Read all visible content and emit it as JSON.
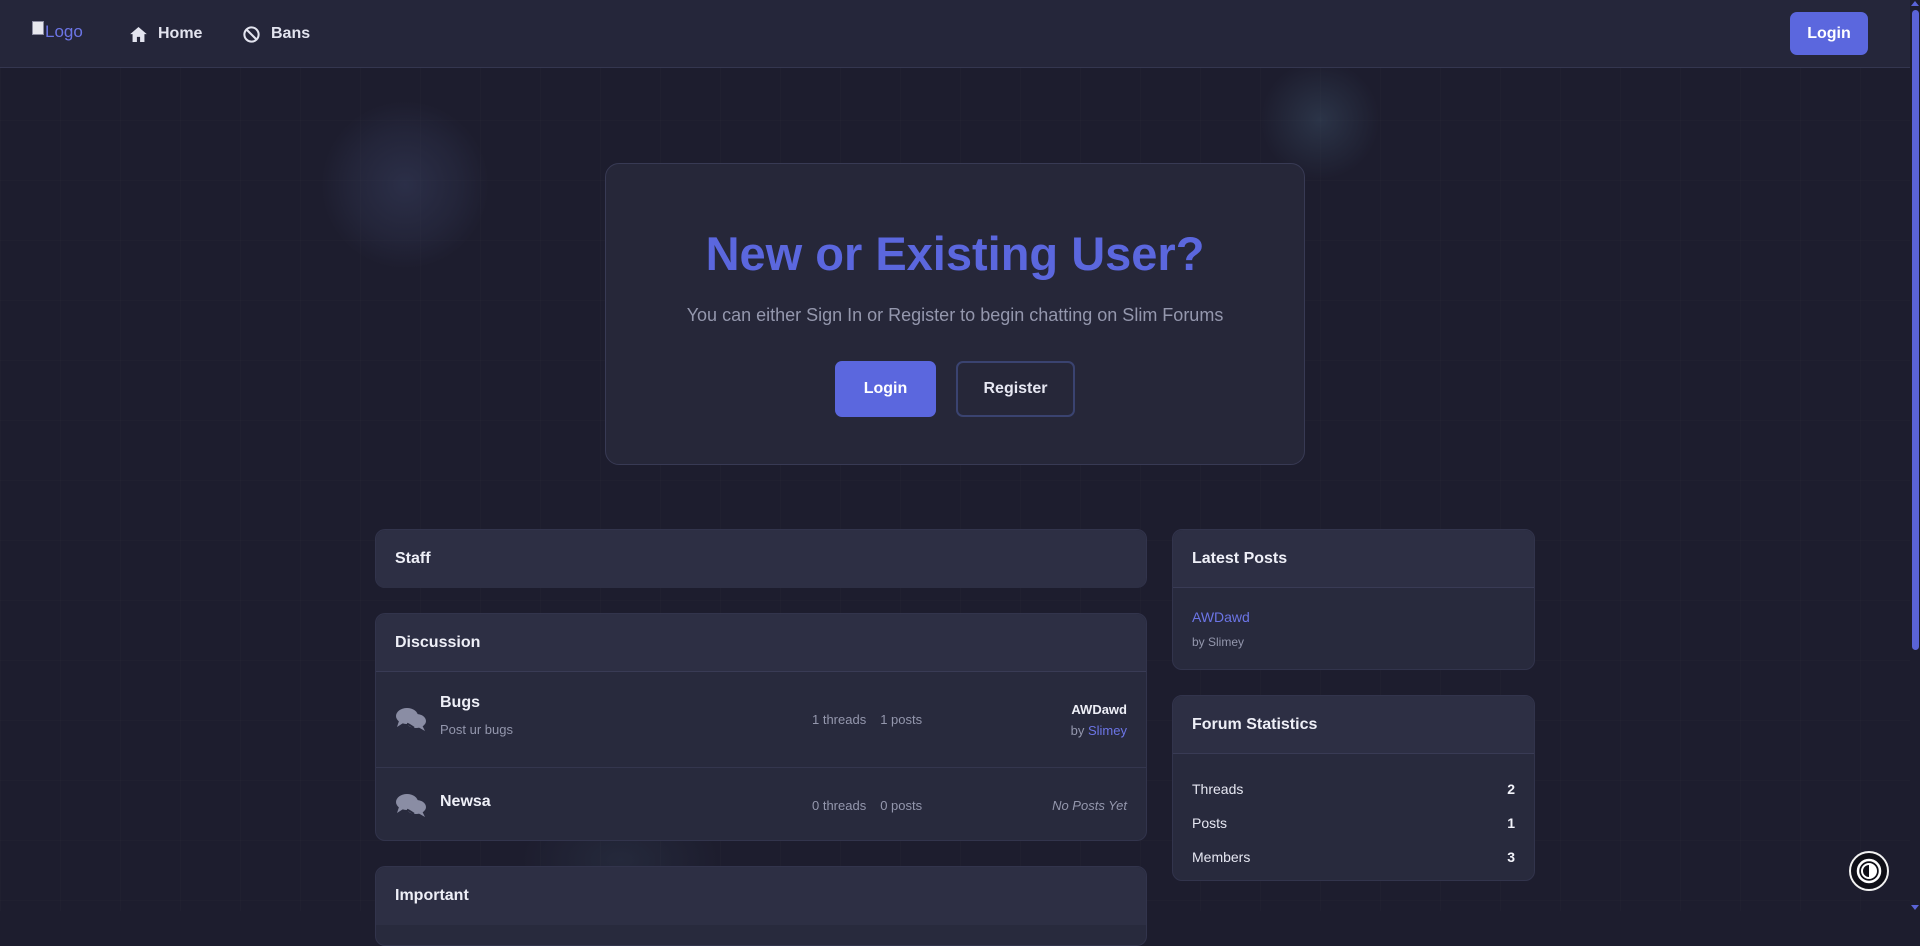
{
  "navbar": {
    "logo_alt": "Logo",
    "links": [
      {
        "label": "Home",
        "icon": "home-icon"
      },
      {
        "label": "Bans",
        "icon": "ban-icon"
      }
    ],
    "login_label": "Login"
  },
  "hero": {
    "title": "New or Existing User?",
    "subtitle": "You can either Sign In or Register to begin chatting on Slim Forums",
    "login_label": "Login",
    "register_label": "Register"
  },
  "categories": [
    {
      "title": "Staff",
      "forums": []
    },
    {
      "title": "Discussion",
      "forums": [
        {
          "name": "Bugs",
          "description": "Post ur bugs",
          "threads": "1 threads",
          "posts": "1 posts",
          "last_post_title": "AWDawd",
          "last_post_by_prefix": "by",
          "last_post_author": "Slimey"
        },
        {
          "name": "Newsa",
          "description": "",
          "threads": "0 threads",
          "posts": "0 posts",
          "no_posts": "No Posts Yet"
        }
      ]
    },
    {
      "title": "Important",
      "forums": []
    }
  ],
  "latest_posts": {
    "title": "Latest Posts",
    "items": [
      {
        "title": "AWDawd",
        "by": "by Slimey"
      }
    ]
  },
  "forum_statistics": {
    "title": "Forum Statistics",
    "rows": [
      {
        "label": "Threads",
        "value": "2"
      },
      {
        "label": "Posts",
        "value": "1"
      },
      {
        "label": "Members",
        "value": "3"
      }
    ]
  },
  "colors": {
    "accent": "#5b67de",
    "background": "#1d1d2e",
    "card": "#282a3d",
    "text_muted": "#9497ad"
  }
}
